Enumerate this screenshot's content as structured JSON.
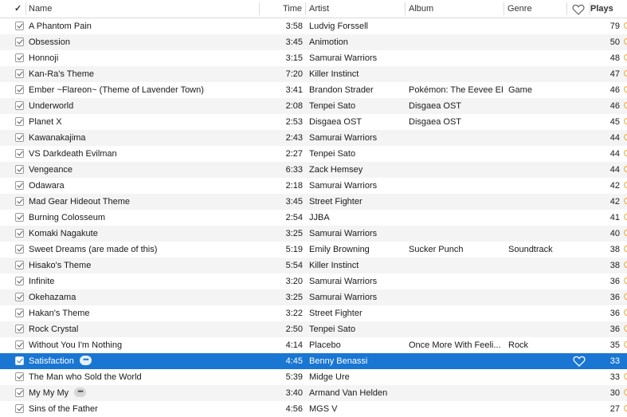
{
  "header": {
    "check": "✓",
    "name": "Name",
    "time": "Time",
    "artist": "Artist",
    "album": "Album",
    "genre": "Genre",
    "plays": "Plays"
  },
  "selected_index": 21,
  "colors": {
    "selection": "#1976d2",
    "stripe": "#f4f4f4"
  },
  "tracks": [
    {
      "name": "A Phantom Pain",
      "time": "3:58",
      "artist": "Ludvig Forssell",
      "album": "",
      "genre": "",
      "plays": "79"
    },
    {
      "name": "Obsession",
      "time": "3:45",
      "artist": "Animotion",
      "album": "",
      "genre": "",
      "plays": "50"
    },
    {
      "name": "Honnoji",
      "time": "3:15",
      "artist": "Samurai Warriors",
      "album": "",
      "genre": "",
      "plays": "48"
    },
    {
      "name": "Kan-Ra's Theme",
      "time": "7:20",
      "artist": "Killer Instinct",
      "album": "",
      "genre": "",
      "plays": "47"
    },
    {
      "name": "Ember ~Flareon~ (Theme of Lavender Town)",
      "time": "3:41",
      "artist": "Brandon Strader",
      "album": "Pokémon: The Eevee EP",
      "genre": "Game",
      "plays": "46"
    },
    {
      "name": "Underworld",
      "time": "2:08",
      "artist": "Tenpei Sato",
      "album": "Disgaea OST",
      "genre": "",
      "plays": "46"
    },
    {
      "name": "Planet X",
      "time": "2:53",
      "artist": "Disgaea OST",
      "album": "Disgaea OST",
      "genre": "",
      "plays": "45"
    },
    {
      "name": "Kawanakajima",
      "time": "2:43",
      "artist": "Samurai Warriors",
      "album": "",
      "genre": "",
      "plays": "44"
    },
    {
      "name": "VS Darkdeath Evilman",
      "time": "2:27",
      "artist": "Tenpei Sato",
      "album": "",
      "genre": "",
      "plays": "44"
    },
    {
      "name": "Vengeance",
      "time": "6:33",
      "artist": "Zack Hemsey",
      "album": "",
      "genre": "",
      "plays": "44"
    },
    {
      "name": "Odawara",
      "time": "2:18",
      "artist": "Samurai Warriors",
      "album": "",
      "genre": "",
      "plays": "42"
    },
    {
      "name": "Mad Gear Hideout Theme",
      "time": "3:45",
      "artist": "Street Fighter",
      "album": "",
      "genre": "",
      "plays": "42"
    },
    {
      "name": "Burning Colosseum",
      "time": "2:54",
      "artist": "JJBA",
      "album": "",
      "genre": "",
      "plays": "41"
    },
    {
      "name": "Komaki Nagakute",
      "time": "3:25",
      "artist": "Samurai Warriors",
      "album": "",
      "genre": "",
      "plays": "40"
    },
    {
      "name": "Sweet Dreams (are made of this)",
      "time": "5:19",
      "artist": "Emily Browning",
      "album": "Sucker Punch",
      "genre": "Soundtrack",
      "plays": "38"
    },
    {
      "name": "Hisako's Theme",
      "time": "5:54",
      "artist": "Killer Instinct",
      "album": "",
      "genre": "",
      "plays": "38"
    },
    {
      "name": "Infinite",
      "time": "3:20",
      "artist": "Samurai Warriors",
      "album": "",
      "genre": "",
      "plays": "36"
    },
    {
      "name": "Okehazama",
      "time": "3:25",
      "artist": "Samurai Warriors",
      "album": "",
      "genre": "",
      "plays": "36"
    },
    {
      "name": "Hakan's Theme",
      "time": "3:22",
      "artist": "Street Fighter",
      "album": "",
      "genre": "",
      "plays": "36"
    },
    {
      "name": "Rock Crystal",
      "time": "2:50",
      "artist": "Tenpei Sato",
      "album": "",
      "genre": "",
      "plays": "36"
    },
    {
      "name": "Without You I'm Nothing",
      "time": "4:14",
      "artist": "Placebo",
      "album": "Once More With Feeli...",
      "genre": "Rock",
      "plays": "35"
    },
    {
      "name": "Satisfaction",
      "time": "4:45",
      "artist": "Benny Benassi",
      "album": "",
      "genre": "",
      "plays": "33",
      "more": "•••",
      "heart": true
    },
    {
      "name": "The Man who Sold the World",
      "time": "5:39",
      "artist": "Midge Ure",
      "album": "",
      "genre": "",
      "plays": "33"
    },
    {
      "name": "My My My",
      "time": "3:40",
      "artist": "Armand Van Helden",
      "album": "",
      "genre": "",
      "plays": "30",
      "more": "•••"
    },
    {
      "name": "Sins of the Father",
      "time": "4:56",
      "artist": "MGS V",
      "album": "",
      "genre": "",
      "plays": "27"
    }
  ]
}
